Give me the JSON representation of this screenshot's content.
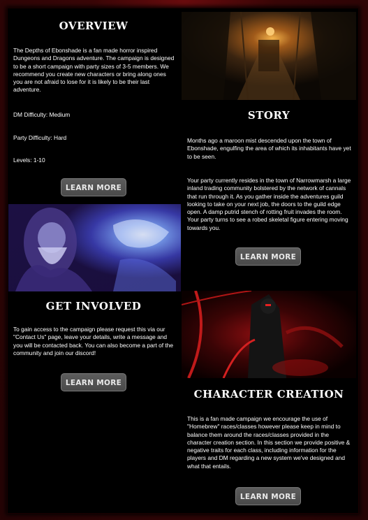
{
  "overview": {
    "heading": "OVERVIEW",
    "description": "The Depths of Ebonshade is a fan made horror inspired Dungeons and Dragons adventure. The campaign is designed to be a short campaign with party sizes of 3-5 members. We recommend you create new characters or bring along ones you are not afraid to lose for it is likely to be their last adventure.",
    "dm_difficulty": "DM Difficulty: Medium",
    "party_difficulty": "Party Difficulty: Hard",
    "levels": "Levels: 1-10",
    "button": "LEARN MORE"
  },
  "story": {
    "heading": "STORY",
    "paragraph1": "Months ago a maroon mist descended upon the town of Ebonshade, engulfing the area of which its inhabitants have yet to be seen.",
    "paragraph2": "Your party currently resides in the town of Narrowmarsh a large inland trading community bolstered by the network of cannals that run through it. As you gather inside the adventures guild looking to take on your next job, the doors to the guild edge open. A damp putrid stench of rotting fruit invades the room. Your party turns to see a robed skeletal figure entering moving towards you.",
    "button": "LEARN MORE"
  },
  "get_involved": {
    "heading": "GET INVOLVED",
    "description": "To gain access to the campaign please request this via our \"Contact Us\" page, leave your details, write a message and you will be contacted back. You can also become a part of the community and join our discord!",
    "button": "LEARN MORE"
  },
  "character_creation": {
    "heading": "CHARACTER CREATION",
    "description": "This is a fan made campaign we encourage the use of \"Homebrew\" races/classes however please keep in mind to balance them around the races/classes provided in the character creation section. In this section we provide positive & negative traits for each class, including information for the players and DM regarding a new system we've designed and what that entails.",
    "button": "LEARN MORE"
  },
  "colors": {
    "background": "#3a0607",
    "panel": "#000000",
    "text": "#ffffff",
    "button": "#555555"
  }
}
